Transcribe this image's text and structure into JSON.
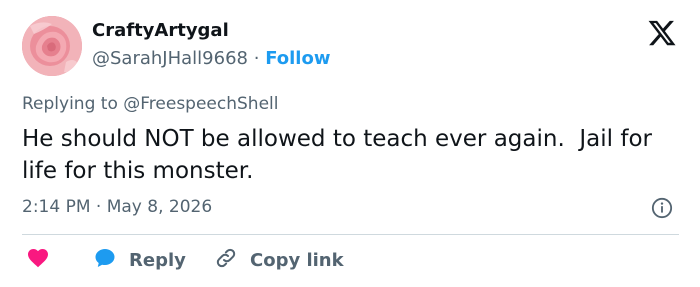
{
  "user": {
    "display_name": "CraftyArtygal",
    "handle": "@SarahJHall9668",
    "separator": "·",
    "follow_label": "Follow"
  },
  "reply_context": {
    "prefix": "Replying to",
    "mention": "@FreespeechShell"
  },
  "tweet": {
    "text": "He should NOT be allowed to teach ever again.  Jail for life for this monster."
  },
  "meta": {
    "timestamp": "2:14 PM · May 8, 2026"
  },
  "actions": {
    "reply_label": "Reply",
    "copy_link_label": "Copy link"
  },
  "icons": {
    "brand": "x-logo-icon",
    "info": "info-icon",
    "like": "heart-icon",
    "reply": "speech-bubble-icon",
    "copy": "link-icon"
  },
  "colors": {
    "accent": "#1d9bf0",
    "heart": "#f91880",
    "text_primary": "#0f1419",
    "text_secondary": "#536471",
    "divider": "#cfd9de"
  }
}
